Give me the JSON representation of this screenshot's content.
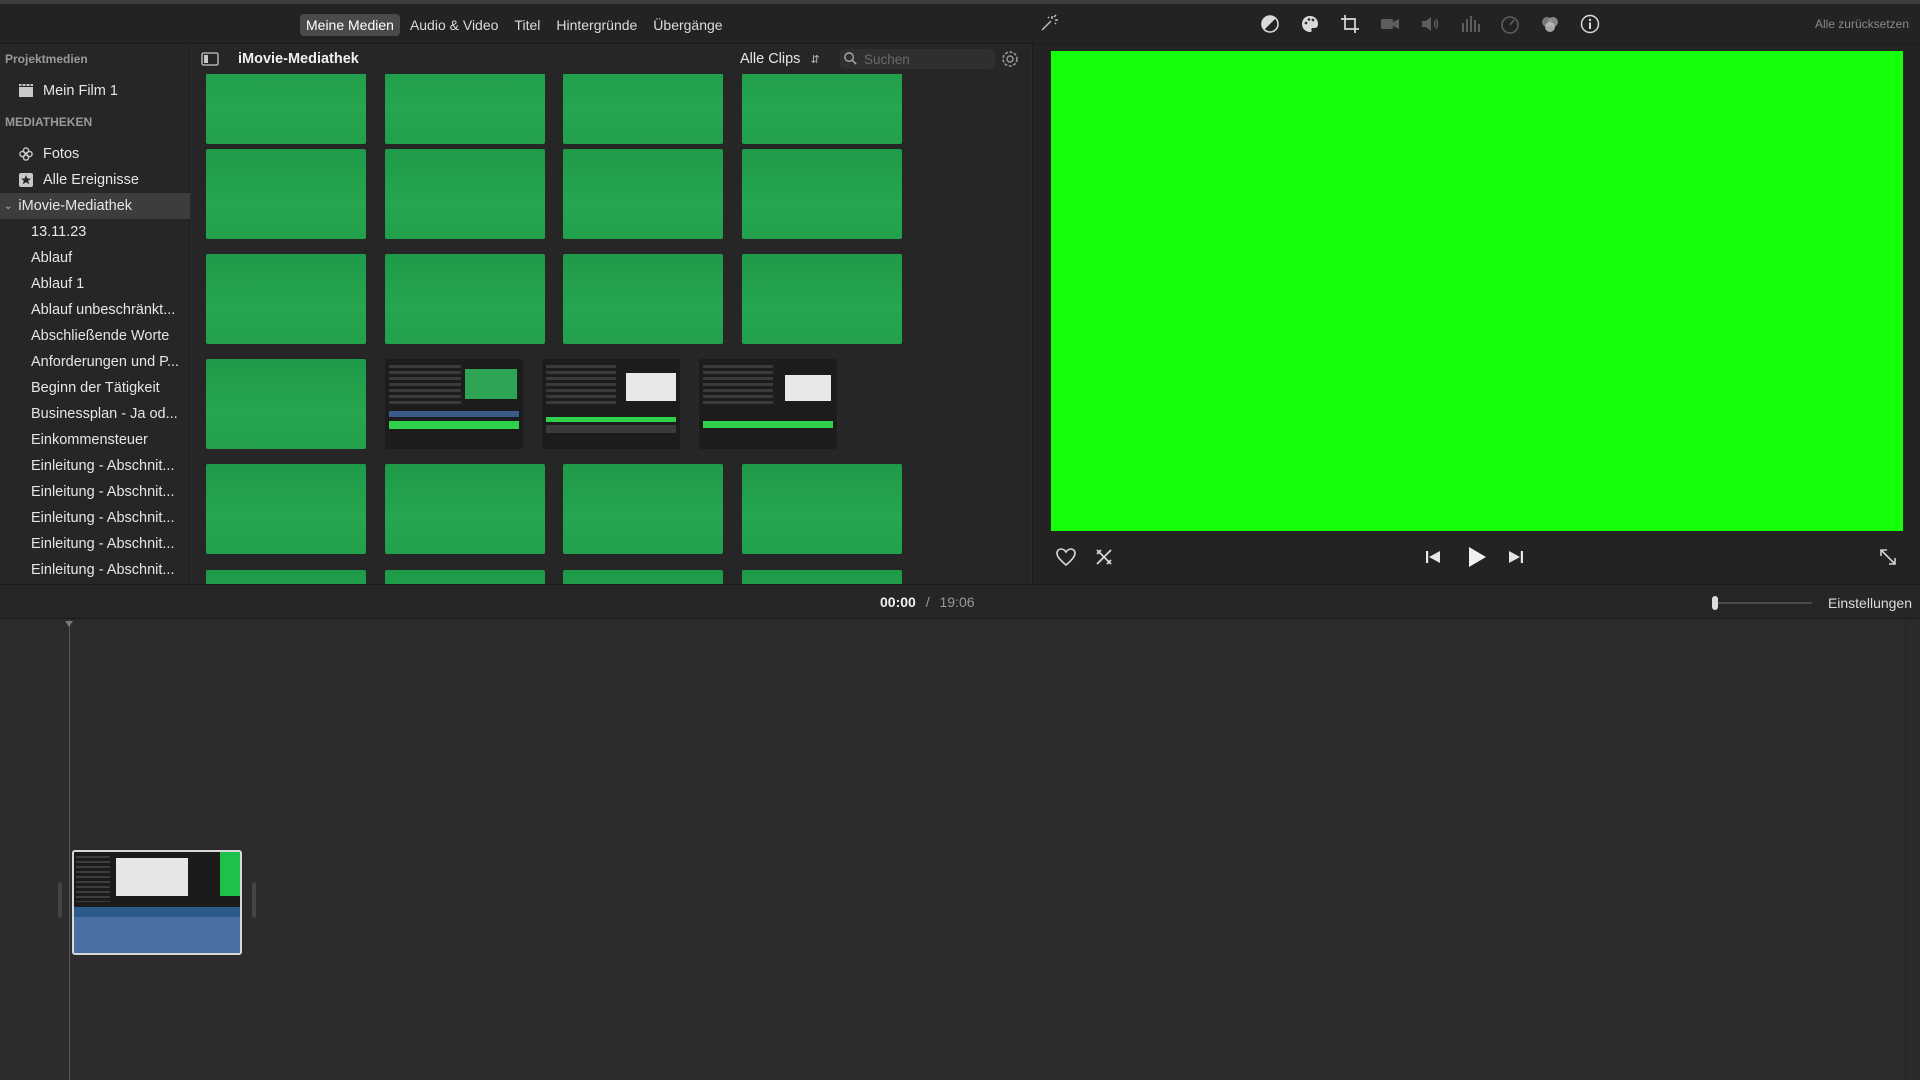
{
  "toolbar": {
    "tabs": [
      "Meine Medien",
      "Audio & Video",
      "Titel",
      "Hintergründe",
      "Übergänge"
    ],
    "reset_all": "Alle zurücksetzen",
    "icons": [
      "magic-wand-icon",
      "color-balance-icon",
      "color-palette-icon",
      "crop-icon",
      "stabilization-icon",
      "volume-icon",
      "equalizer-icon",
      "speed-icon",
      "filter-icon",
      "info-icon"
    ]
  },
  "sidebar": {
    "project_media": "Projektmedien",
    "film": "Mein Film 1",
    "libraries": "MEDIATHEKEN",
    "photos": "Fotos",
    "all_events": "Alle Ereignisse",
    "library": "iMovie-Mediathek",
    "events": [
      "13.11.23",
      "Ablauf",
      "Ablauf 1",
      "Ablauf unbeschränkt...",
      "Abschließende Worte",
      "Anforderungen und P...",
      "Beginn der Tätigkeit",
      "Businessplan - Ja od...",
      "Einkommensteuer",
      "Einleitung - Abschnit...",
      "Einleitung - Abschnit...",
      "Einleitung - Abschnit...",
      "Einleitung - Abschnit...",
      "Einleitung - Abschnit..."
    ]
  },
  "browser": {
    "title": "iMovie-Mediathek",
    "filter": "Alle Clips",
    "search_placeholder": "Suchen"
  },
  "timeline": {
    "current": "00:00",
    "separator": "/",
    "total": "19:06",
    "settings": "Einstellungen"
  },
  "colors": {
    "viewer_green": "#14ff0a",
    "greenscreen": "#22a04c"
  }
}
